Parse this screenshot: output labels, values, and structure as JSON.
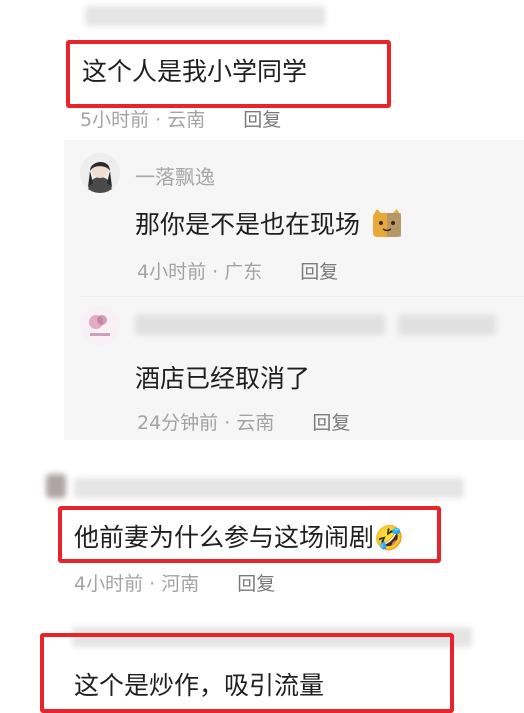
{
  "comments": [
    {
      "text": "这个人是我小学同学",
      "time": "5小时前",
      "region": "云南",
      "reply_label": "回复"
    },
    {
      "text": "他前妻为什么参与这场闹剧",
      "emoji": "🤣",
      "time": "4小时前",
      "region": "河南",
      "reply_label": "回复"
    },
    {
      "text": "这个是炒作，吸引流量"
    }
  ],
  "replies": [
    {
      "username": "一落飘逸",
      "text": "那你是不是也在现场",
      "time": "4小时前",
      "region": "广东",
      "reply_label": "回复"
    },
    {
      "text": "酒店已经取消了",
      "time": "24分钟前",
      "region": "云南",
      "reply_label": "回复"
    }
  ],
  "meta_separator": "·",
  "colors": {
    "highlight_border": "#e8232a",
    "reply_background": "#f6f6f6",
    "meta_gray": "#a3a3a3"
  }
}
